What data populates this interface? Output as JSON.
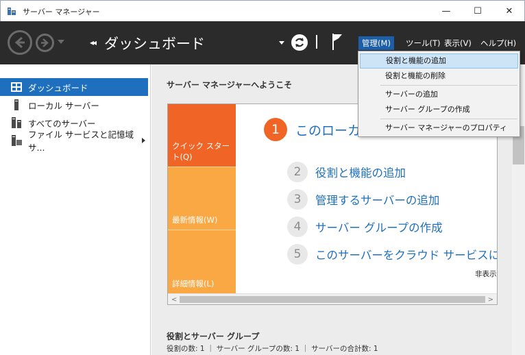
{
  "window": {
    "title": "サーバー マネージャー",
    "min_glyph": "—",
    "max_glyph": "☐",
    "close_glyph": "✕"
  },
  "header": {
    "crumb_arrows": "◂◂",
    "breadcrumb": "ダッシュボード",
    "menus": {
      "manage": "管理(M)",
      "tools": "ツール(T)",
      "view": "表示(V)",
      "help": "ヘルプ(H)"
    }
  },
  "sidebar": {
    "items": [
      {
        "label": "ダッシュボード",
        "icon": "dashboard-icon"
      },
      {
        "label": "ローカル サーバー",
        "icon": "server-icon"
      },
      {
        "label": "すべてのサーバー",
        "icon": "servers-icon"
      },
      {
        "label": "ファイル サービスと記憶域サ...",
        "icon": "file-storage-icon"
      }
    ]
  },
  "main": {
    "welcome_title": "サーバー マネージャーへようこそ",
    "tiles": {
      "quick_start": "クイック スタート(Q)",
      "whats_new": "最新情報(W)",
      "learn_more": "詳細情報(L)"
    },
    "step1": {
      "number": "1",
      "label": "このローカル サーバーの構成"
    },
    "steps": [
      {
        "number": "2",
        "label": "役割と機能の追加"
      },
      {
        "number": "3",
        "label": "管理するサーバーの追加"
      },
      {
        "number": "4",
        "label": "サーバー グループの作成"
      },
      {
        "number": "5",
        "label": "このサーバーをクラウド サービスに接続する"
      }
    ],
    "hide_label": "非表示",
    "roles_title": "役割とサーバー グループ",
    "roles_stats": "役割の数: 1 ｜ サーバー グループの数: 1 ｜ サーバーの合計数: 1"
  },
  "manage_menu": {
    "items": [
      "役割と機能の追加",
      "役割と機能の削除",
      "サーバーの追加",
      "サーバー グループの作成",
      "サーバー マネージャーのプロパティ"
    ]
  },
  "scroll": {
    "left_arrow": "<",
    "right_arrow": ">"
  }
}
